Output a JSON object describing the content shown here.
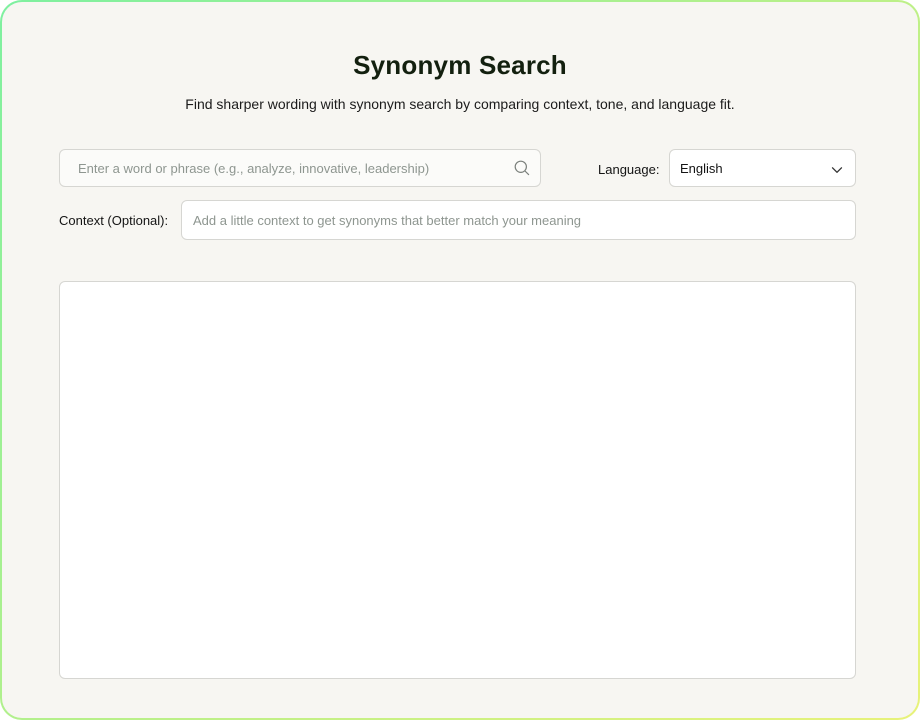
{
  "page": {
    "title": "Synonym Search",
    "subtitle": "Find sharper wording with synonym search by comparing context, tone, and language fit."
  },
  "search": {
    "placeholder": "Enter a word or phrase (e.g., analyze, innovative, leadership)",
    "value": "",
    "icon": "search-icon"
  },
  "language": {
    "label": "Language:",
    "selected": "English",
    "icon": "chevron-down-icon"
  },
  "context": {
    "label": "Context (Optional):",
    "placeholder": "Add a little context to get synonyms that better match your meaning",
    "value": ""
  },
  "results": {
    "items": []
  },
  "colors": {
    "border_gradient_start": "#7ef0a0",
    "border_gradient_end": "#e8f27a",
    "card_background": "#f7f6f2",
    "title_color": "#13200f"
  }
}
